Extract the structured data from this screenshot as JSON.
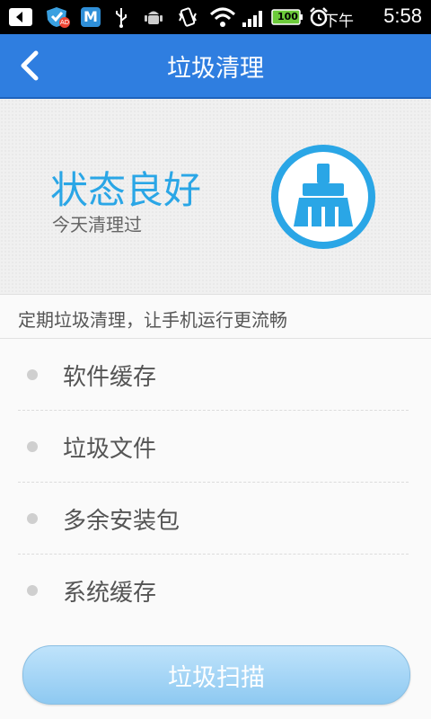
{
  "statusbar": {
    "ampm": "下午",
    "time": "5:58",
    "battery": "100",
    "ad_badge": "AD",
    "app_badge": "M",
    "icons": [
      "back-arrow-icon",
      "shield-ad-icon",
      "app-m-icon",
      "usb-icon",
      "android-debug-icon",
      "vibrate-icon",
      "wifi-icon",
      "signal-icon",
      "battery-icon",
      "alarm-icon"
    ]
  },
  "header": {
    "title": "垃圾清理"
  },
  "status": {
    "title": "状态良好",
    "subtitle": "今天清理过",
    "accent": "#2aa6e6",
    "icon": "broom-icon"
  },
  "description": "定期垃圾清理，让手机运行更流畅",
  "items": [
    {
      "label": "软件缓存"
    },
    {
      "label": "垃圾文件"
    },
    {
      "label": "多余安装包"
    },
    {
      "label": "系统缓存"
    }
  ],
  "scan_button": {
    "label": "垃圾扫描"
  },
  "colors": {
    "titlebar": "#2f7ee0",
    "accent": "#2aa6e6",
    "button": "#a7d7f6"
  }
}
